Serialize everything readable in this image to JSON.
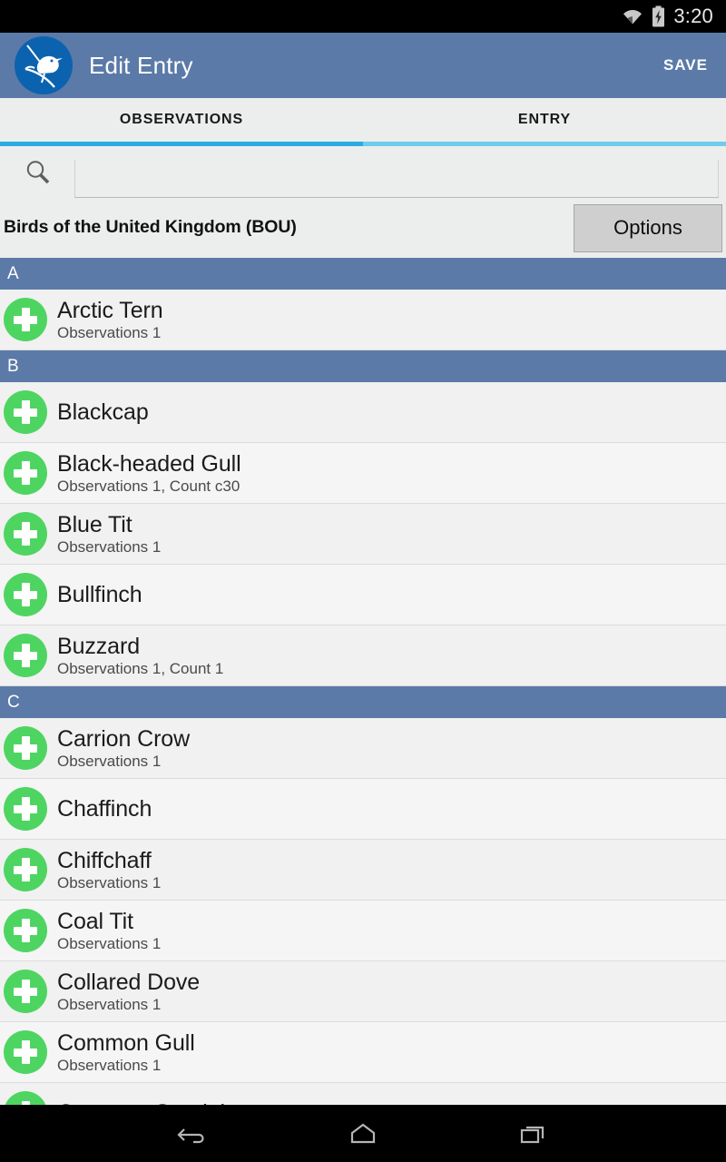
{
  "statusbar": {
    "time": "3:20",
    "wifi_icon": "wifi-icon",
    "battery_icon": "battery-charging-icon"
  },
  "actionbar": {
    "title": "Edit Entry",
    "save_label": "SAVE",
    "logo_icon": "bird-logo-icon",
    "background_color": "#5b7aa8"
  },
  "tabs": {
    "items": [
      {
        "label": "OBSERVATIONS",
        "selected": true
      },
      {
        "label": "ENTRY",
        "selected": false
      }
    ],
    "indicator_color": "#2aabe2",
    "underline_color": "#6fcced"
  },
  "search": {
    "icon": "search-icon",
    "value": "",
    "placeholder": ""
  },
  "list_header": {
    "title": "Birds of the United Kingdom (BOU)",
    "options_label": "Options"
  },
  "list": {
    "accent_color": "#4ed561",
    "section_color": "#5b7aa8",
    "sections": [
      {
        "letter": "A",
        "rows": [
          {
            "name": "Arctic Tern",
            "detail": "Observations 1",
            "add_icon": "plus-circle-icon"
          }
        ]
      },
      {
        "letter": "B",
        "rows": [
          {
            "name": "Blackcap",
            "detail": "",
            "add_icon": "plus-circle-icon"
          },
          {
            "name": "Black-headed Gull",
            "detail": "Observations 1, Count c30",
            "add_icon": "plus-circle-icon"
          },
          {
            "name": "Blue Tit",
            "detail": "Observations 1",
            "add_icon": "plus-circle-icon"
          },
          {
            "name": "Bullfinch",
            "detail": "",
            "add_icon": "plus-circle-icon"
          },
          {
            "name": "Buzzard",
            "detail": "Observations 1, Count 1",
            "add_icon": "plus-circle-icon"
          }
        ]
      },
      {
        "letter": "C",
        "rows": [
          {
            "name": "Carrion Crow",
            "detail": "Observations 1",
            "add_icon": "plus-circle-icon"
          },
          {
            "name": "Chaffinch",
            "detail": "",
            "add_icon": "plus-circle-icon"
          },
          {
            "name": "Chiffchaff",
            "detail": "Observations 1",
            "add_icon": "plus-circle-icon"
          },
          {
            "name": "Coal Tit",
            "detail": "Observations 1",
            "add_icon": "plus-circle-icon"
          },
          {
            "name": "Collared Dove",
            "detail": "Observations 1",
            "add_icon": "plus-circle-icon"
          },
          {
            "name": "Common Gull",
            "detail": "Observations 1",
            "add_icon": "plus-circle-icon"
          },
          {
            "name": "Common Sandpiper",
            "detail": "",
            "add_icon": "plus-circle-icon"
          }
        ]
      }
    ]
  },
  "navbar": {
    "back_icon": "back-arrow-icon",
    "home_icon": "home-icon",
    "recents_icon": "recents-icon"
  }
}
